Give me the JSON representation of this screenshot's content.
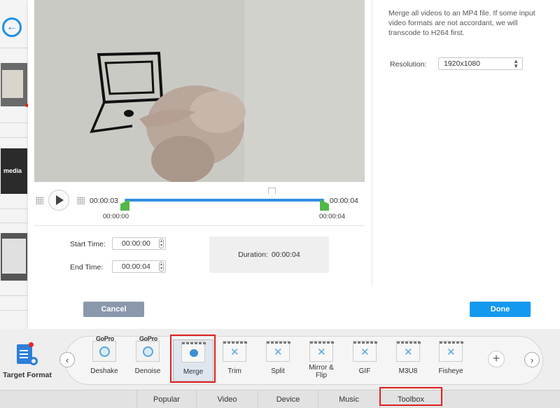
{
  "background": {
    "thumb_text": "media"
  },
  "dialog": {
    "merge_description": "Merge all videos to an MP4 file. If some input video formats are not accordant, we will transcode to H264 first.",
    "resolution_label": "Resolution:",
    "resolution_value": "1920x1080",
    "current_time": "00:00:03",
    "end_time_top": "00:00:04",
    "range_start": "00:00:00",
    "range_end": "00:00:04",
    "start_time_label": "Start Time:",
    "start_time_value": "00:00:00",
    "end_time_label": "End Time:",
    "end_time_value": "00:00:04",
    "duration_label": "Duration:",
    "duration_value": "00:00:04",
    "cancel_label": "Cancel",
    "done_label": "Done"
  },
  "toolbar": {
    "target_format_label": "Target Format",
    "tools": [
      {
        "label": "Deshake",
        "icon": "gopro-deshake-icon",
        "badge": "GoPro"
      },
      {
        "label": "Denoise",
        "icon": "gopro-denoise-icon",
        "badge": "GoPro"
      },
      {
        "label": "Merge",
        "icon": "merge-icon",
        "selected": true
      },
      {
        "label": "Trim",
        "icon": "trim-icon"
      },
      {
        "label": "Split",
        "icon": "split-icon"
      },
      {
        "label": "Mirror & Flip",
        "icon": "mirror-flip-icon"
      },
      {
        "label": "GIF",
        "icon": "gif-icon"
      },
      {
        "label": "M3U8",
        "icon": "m3u8-icon"
      },
      {
        "label": "Fisheye",
        "icon": "fisheye-icon"
      }
    ],
    "tabs": [
      "Popular",
      "Video",
      "Device",
      "Music",
      "Toolbox"
    ],
    "active_tab": "Toolbox"
  },
  "colors": {
    "accent": "#1499f0",
    "timeline": "#2f8ee3",
    "handle": "#52b848",
    "highlight": "#e02020",
    "cancel": "#8b97ab"
  }
}
